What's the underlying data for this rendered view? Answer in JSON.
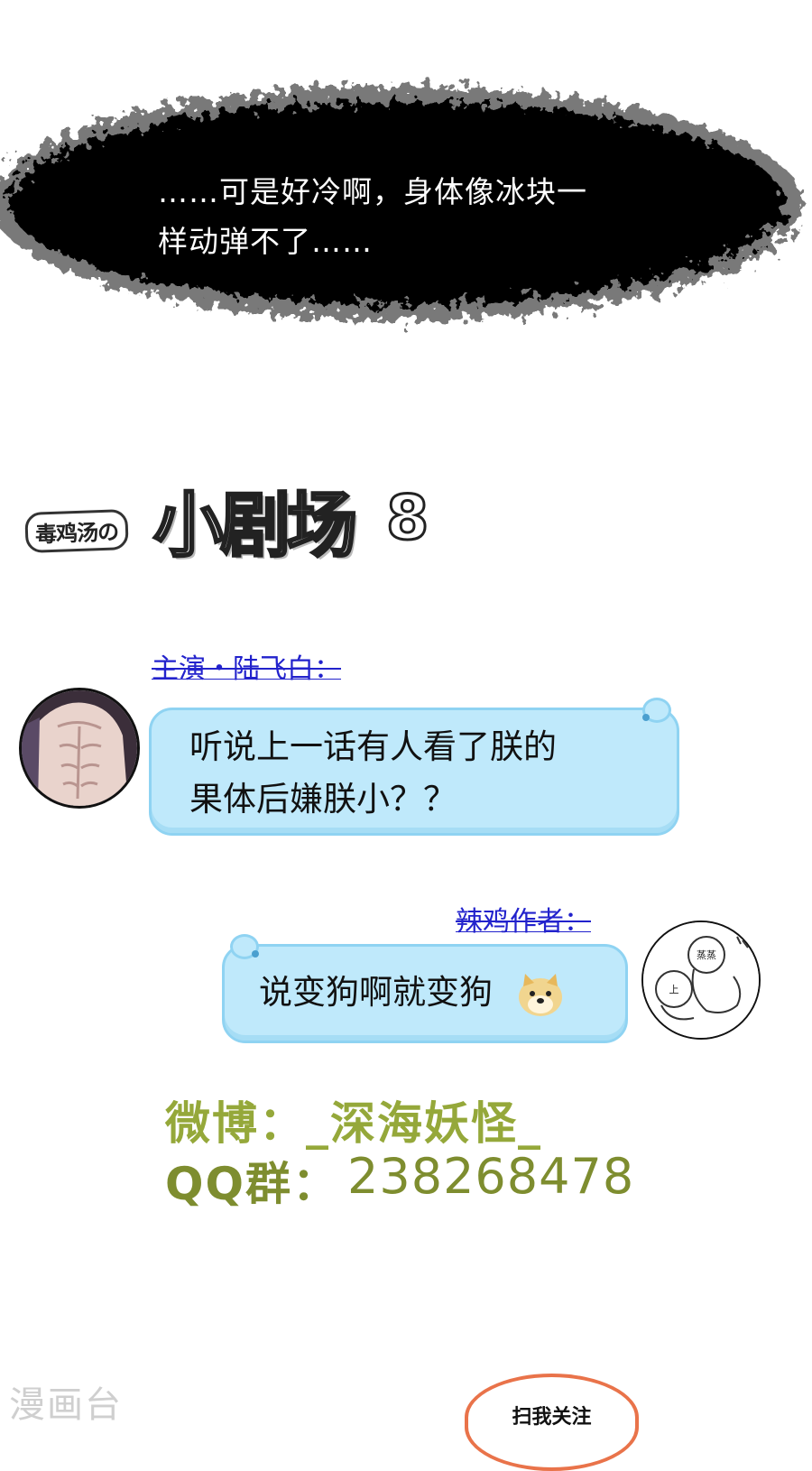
{
  "narration": {
    "line1": "……可是好冷啊，身体像冰块一",
    "line2": "样动弹不了……"
  },
  "title": {
    "small": "毒鸡汤の",
    "big": "小剧场",
    "number": "8"
  },
  "dialog": [
    {
      "speaker": "主演・陆飞白：",
      "line1": "听说上一话有人看了朕的",
      "line2": "果体后嫌朕小？？"
    },
    {
      "speaker": "辣鸡作者：",
      "line1": "说变狗啊就变狗",
      "avatar_labels": [
        "蒸蒸",
        "上"
      ]
    }
  ],
  "social": {
    "weibo": "微博：_深海妖怪_",
    "qq_label": "QQ群：",
    "qq_number": "238268478"
  },
  "watermark": "漫画台",
  "scan_label": "扫我关注",
  "colors": {
    "bubble_fill": "#bfe9fb",
    "bubble_border": "#8fd3f2",
    "speaker_blue": "#2222cc",
    "social_green": "#7e8d2f",
    "scan_orange": "#e9734a"
  }
}
